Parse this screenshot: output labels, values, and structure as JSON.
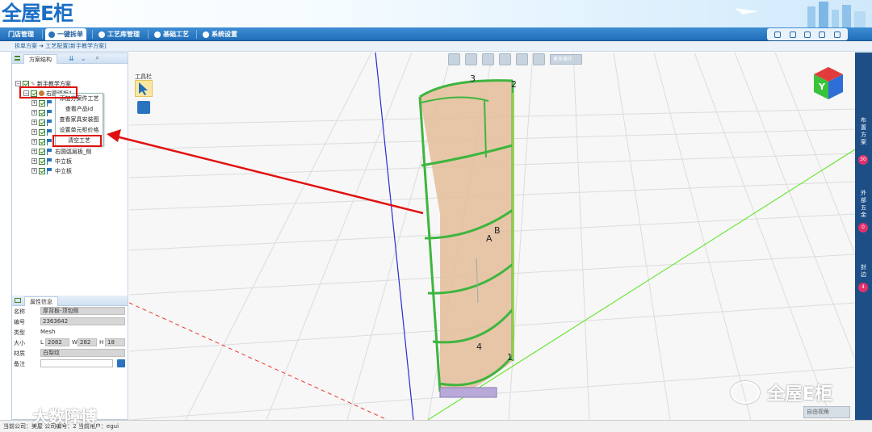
{
  "app": {
    "logo_text": "全屋E柜"
  },
  "nav": {
    "tabs": [
      "门店管理",
      "一键拆单",
      "工艺库管理",
      "基础工艺",
      "系统设置"
    ],
    "active_index": 1
  },
  "breadcrumb": "拆单方案 ➔ 工艺配置[新手教学方案]",
  "left_panel": {
    "title": "方案结构",
    "tree": [
      {
        "label": "新手教学方案",
        "level": 0
      },
      {
        "label": "右圆弧柜1",
        "level": 1
      },
      {
        "label": "",
        "level": 2
      },
      {
        "label": "",
        "level": 2
      },
      {
        "label": "",
        "level": 2
      },
      {
        "label": "",
        "level": 2
      },
      {
        "label": "",
        "level": 2
      },
      {
        "label": "右圆弧层板_侧",
        "level": 2
      },
      {
        "label": "中立板",
        "level": 2
      },
      {
        "label": "中立板",
        "level": 2
      }
    ],
    "context_menu": [
      "添加方案件工艺",
      "查看产品id",
      "查看家具安装图",
      "设置单元柜价格",
      "清空工艺"
    ]
  },
  "properties": {
    "title": "属性信息",
    "name_label": "名称",
    "name_value": "厚背板-顶包侧",
    "code_label": "编号",
    "code_value": "2363642",
    "type_label": "类型",
    "type_value": "Mesh",
    "size_label": "大小",
    "L_label": "L",
    "L_value": "2082",
    "W_label": "W",
    "W_value": "282",
    "H_label": "H",
    "H_value": "18",
    "material_label": "材质",
    "material_value": "白梨纹",
    "note_label": "备注",
    "note_value": ""
  },
  "viewport": {
    "toolbar_more": "更多操作",
    "toolbox_label": "工具栏",
    "labels": [
      "3",
      "2",
      "A",
      "B",
      "4",
      "1"
    ],
    "view_cube_face": "Y",
    "camera_select": "自由视角"
  },
  "right_panel": [
    {
      "label": "布置方案",
      "count": "30"
    },
    {
      "label": "外部五金",
      "count": "0"
    },
    {
      "label": "封边",
      "count": "4"
    }
  ],
  "status_bar": "当前公司：美屋   公司编号：2   当前用户：egui",
  "watermarks": {
    "left": "大数障博",
    "right": "全屋E柜"
  },
  "colors": {
    "nav_blue": "#1f6db8",
    "highlight_red": "#e01010",
    "panel_dark": "#1d4f86",
    "badge": "#e1306c",
    "cabinet_edge": "#3fb53f"
  }
}
